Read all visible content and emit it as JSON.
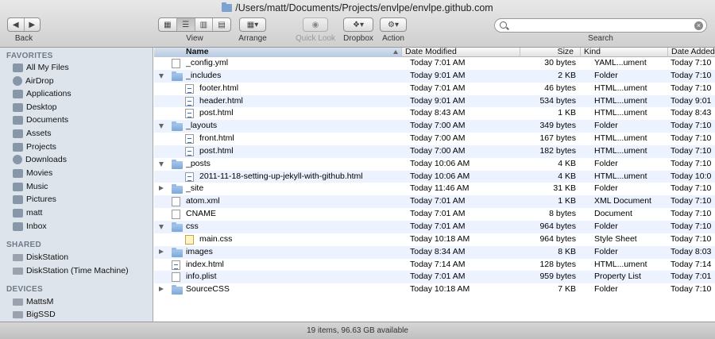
{
  "window": {
    "title": "/Users/matt/Documents/Projects/envlpe/envlpe.github.com"
  },
  "toolbar": {
    "back_label": "Back",
    "view_label": "View",
    "arrange_label": "Arrange",
    "quicklook_label": "Quick Look",
    "dropbox_label": "Dropbox",
    "action_label": "Action",
    "search_label": "Search",
    "search_value": ""
  },
  "sidebar": {
    "favorites_title": "FAVORITES",
    "favorites": [
      {
        "label": "All My Files"
      },
      {
        "label": "AirDrop"
      },
      {
        "label": "Applications"
      },
      {
        "label": "Desktop"
      },
      {
        "label": "Documents"
      },
      {
        "label": "Assets"
      },
      {
        "label": "Projects"
      },
      {
        "label": "Downloads"
      },
      {
        "label": "Movies"
      },
      {
        "label": "Music"
      },
      {
        "label": "Pictures"
      },
      {
        "label": "matt"
      },
      {
        "label": "Inbox"
      }
    ],
    "shared_title": "SHARED",
    "shared": [
      {
        "label": "DiskStation"
      },
      {
        "label": "DiskStation (Time Machine)"
      }
    ],
    "devices_title": "DEVICES",
    "devices": [
      {
        "label": "MattsM"
      },
      {
        "label": "BigSSD"
      }
    ]
  },
  "columns": {
    "name": "Name",
    "date": "Date Modified",
    "size": "Size",
    "kind": "Kind",
    "added": "Date Added"
  },
  "files": [
    {
      "name": "_config.yml",
      "date": "Today 7:01 AM",
      "size": "30 bytes",
      "kind": "YAML...ument",
      "added": "Today 7:10",
      "icon": "doc",
      "level": 0,
      "disclosure": "none"
    },
    {
      "name": "_includes",
      "date": "Today 9:01 AM",
      "size": "2 KB",
      "kind": "Folder",
      "added": "Today 7:10",
      "icon": "folder",
      "level": 0,
      "disclosure": "open"
    },
    {
      "name": "footer.html",
      "date": "Today 7:01 AM",
      "size": "46 bytes",
      "kind": "HTML...ument",
      "added": "Today 7:10",
      "icon": "html",
      "level": 1,
      "disclosure": "none"
    },
    {
      "name": "header.html",
      "date": "Today 9:01 AM",
      "size": "534 bytes",
      "kind": "HTML...ument",
      "added": "Today 9:01",
      "icon": "html",
      "level": 1,
      "disclosure": "none"
    },
    {
      "name": "post.html",
      "date": "Today 8:43 AM",
      "size": "1 KB",
      "kind": "HTML...ument",
      "added": "Today 8:43",
      "icon": "html",
      "level": 1,
      "disclosure": "none"
    },
    {
      "name": "_layouts",
      "date": "Today 7:00 AM",
      "size": "349 bytes",
      "kind": "Folder",
      "added": "Today 7:10",
      "icon": "folder",
      "level": 0,
      "disclosure": "open"
    },
    {
      "name": "front.html",
      "date": "Today 7:00 AM",
      "size": "167 bytes",
      "kind": "HTML...ument",
      "added": "Today 7:10",
      "icon": "html",
      "level": 1,
      "disclosure": "none"
    },
    {
      "name": "post.html",
      "date": "Today 7:00 AM",
      "size": "182 bytes",
      "kind": "HTML...ument",
      "added": "Today 7:10",
      "icon": "html",
      "level": 1,
      "disclosure": "none"
    },
    {
      "name": "_posts",
      "date": "Today 10:06 AM",
      "size": "4 KB",
      "kind": "Folder",
      "added": "Today 7:10",
      "icon": "folder",
      "level": 0,
      "disclosure": "open"
    },
    {
      "name": "2011-11-18-setting-up-jekyll-with-github.html",
      "date": "Today 10:06 AM",
      "size": "4 KB",
      "kind": "HTML...ument",
      "added": "Today 10:0",
      "icon": "html",
      "level": 1,
      "disclosure": "none"
    },
    {
      "name": "_site",
      "date": "Today 11:46 AM",
      "size": "31 KB",
      "kind": "Folder",
      "added": "Today 7:10",
      "icon": "folder",
      "level": 0,
      "disclosure": "closed"
    },
    {
      "name": "atom.xml",
      "date": "Today 7:01 AM",
      "size": "1 KB",
      "kind": "XML Document",
      "added": "Today 7:10",
      "icon": "doc",
      "level": 0,
      "disclosure": "none"
    },
    {
      "name": "CNAME",
      "date": "Today 7:01 AM",
      "size": "8 bytes",
      "kind": "Document",
      "added": "Today 7:10",
      "icon": "doc",
      "level": 0,
      "disclosure": "none"
    },
    {
      "name": "css",
      "date": "Today 7:01 AM",
      "size": "964 bytes",
      "kind": "Folder",
      "added": "Today 7:10",
      "icon": "folder",
      "level": 0,
      "disclosure": "open"
    },
    {
      "name": "main.css",
      "date": "Today 10:18 AM",
      "size": "964 bytes",
      "kind": "Style Sheet",
      "added": "Today 7:10",
      "icon": "css",
      "level": 1,
      "disclosure": "none"
    },
    {
      "name": "images",
      "date": "Today 8:34 AM",
      "size": "8 KB",
      "kind": "Folder",
      "added": "Today 8:03",
      "icon": "folder",
      "level": 0,
      "disclosure": "closed"
    },
    {
      "name": "index.html",
      "date": "Today 7:14 AM",
      "size": "128 bytes",
      "kind": "HTML...ument",
      "added": "Today 7:14",
      "icon": "html",
      "level": 0,
      "disclosure": "none"
    },
    {
      "name": "info.plist",
      "date": "Today 7:01 AM",
      "size": "959 bytes",
      "kind": "Property List",
      "added": "Today 7:01",
      "icon": "doc",
      "level": 0,
      "disclosure": "none"
    },
    {
      "name": "SourceCSS",
      "date": "Today 10:18 AM",
      "size": "7 KB",
      "kind": "Folder",
      "added": "Today 7:10",
      "icon": "folder",
      "level": 0,
      "disclosure": "closed"
    }
  ],
  "status": {
    "text": "19 items, 96.63 GB available"
  }
}
